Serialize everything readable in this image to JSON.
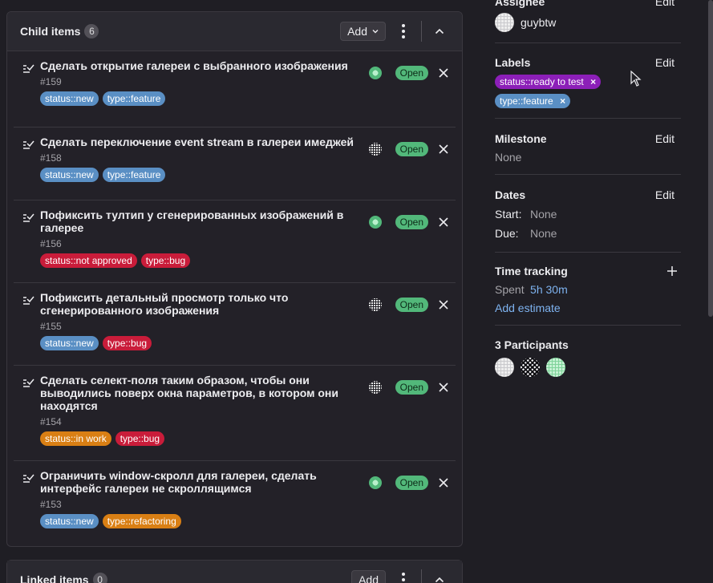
{
  "child_items": {
    "title": "Child items",
    "count": "6",
    "add_label": "Add",
    "items": [
      {
        "title": "Сделать открытие галереи с выбранного изображения",
        "number": "#159",
        "labels": [
          {
            "text": "status::new",
            "color": "#5a8fc4"
          },
          {
            "text": "type::feature",
            "color": "#5a8fc4"
          }
        ],
        "avatar": "green-avatar",
        "status": "Open"
      },
      {
        "title": "Сделать переключение event stream в галереи имеджей",
        "number": "#158",
        "labels": [
          {
            "text": "status::new",
            "color": "#5a8fc4"
          },
          {
            "text": "type::feature",
            "color": "#5a8fc4"
          }
        ],
        "avatar": "pattern-avatar",
        "status": "Open"
      },
      {
        "title": "Пофиксить тултип у сгенерированных изображений в галерее",
        "number": "#156",
        "labels": [
          {
            "text": "status::not approved",
            "color": "#c91c3a"
          },
          {
            "text": "type::bug",
            "color": "#c91c3a"
          }
        ],
        "avatar": "green-avatar",
        "status": "Open"
      },
      {
        "title": "Пофиксить детальный просмотр только что сгенерированного изображения",
        "number": "#155",
        "labels": [
          {
            "text": "status::new",
            "color": "#5a8fc4"
          },
          {
            "text": "type::bug",
            "color": "#c91c3a"
          }
        ],
        "avatar": "pattern-avatar",
        "status": "Open"
      },
      {
        "title": "Сделать селект-поля таким образом, чтобы они выводились поверх окна параметров, в котором они находятся",
        "number": "#154",
        "labels": [
          {
            "text": "status::in work",
            "color": "#d97f14"
          },
          {
            "text": "type::bug",
            "color": "#c91c3a"
          }
        ],
        "avatar": "pattern-avatar",
        "status": "Open"
      },
      {
        "title": "Ограничить window-скролл для галереи, сделать интерфейс галереи не скроллящимся",
        "number": "#153",
        "labels": [
          {
            "text": "status::new",
            "color": "#5a8fc4"
          },
          {
            "text": "type::refactoring",
            "color": "#d97f14"
          }
        ],
        "avatar": "green-avatar",
        "status": "Open"
      }
    ]
  },
  "linked_items": {
    "title": "Linked items",
    "count": "0",
    "add_label": "Add"
  },
  "sidebar": {
    "assignee": {
      "title": "Assignee",
      "edit": "Edit",
      "name": "guybtw"
    },
    "labels": {
      "title": "Labels",
      "edit": "Edit",
      "items": [
        {
          "text": "status::ready to test",
          "color": "#8c1fb8"
        },
        {
          "text": "type::feature",
          "color": "#5a8fc4"
        }
      ]
    },
    "milestone": {
      "title": "Milestone",
      "edit": "Edit",
      "value": "None"
    },
    "dates": {
      "title": "Dates",
      "edit": "Edit",
      "start_label": "Start:",
      "start_value": "None",
      "due_label": "Due:",
      "due_value": "None"
    },
    "time_tracking": {
      "title": "Time tracking",
      "spent_label": "Spent",
      "spent_value": "5h 30m",
      "add_estimate": "Add estimate"
    },
    "participants": {
      "title": "3 Participants"
    }
  },
  "colors": {
    "open_status": "#52b87a",
    "link": "#7eb3f0",
    "background": "#1f1e24"
  }
}
